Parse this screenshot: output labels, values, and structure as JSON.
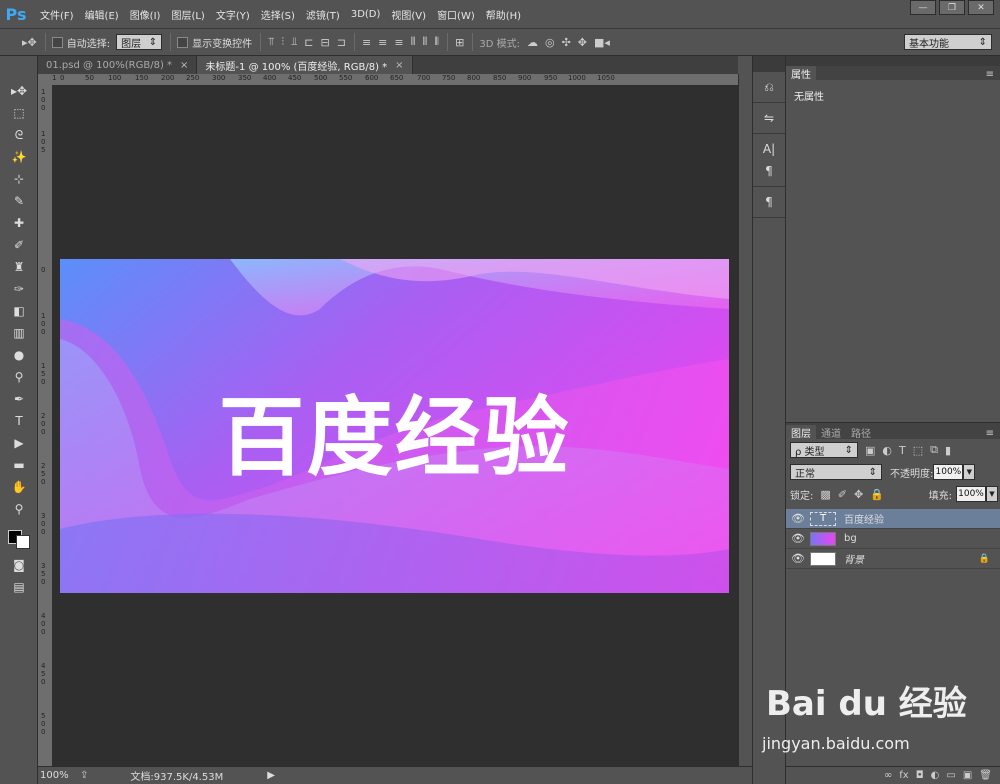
{
  "app": {
    "logo": "Ps"
  },
  "menu": [
    "文件(F)",
    "编辑(E)",
    "图像(I)",
    "图层(L)",
    "文字(Y)",
    "选择(S)",
    "滤镜(T)",
    "3D(D)",
    "视图(V)",
    "窗口(W)",
    "帮助(H)"
  ],
  "window_controls": {
    "minimize": "—",
    "restore": "❐",
    "close": "✕"
  },
  "options_bar": {
    "auto_select_label": "自动选择:",
    "auto_select_value": "图层",
    "show_transform_label": "显示变换控件",
    "mode_3d_label": "3D 模式:",
    "workspace_value": "基本功能"
  },
  "tabs": [
    {
      "label": "01.psd @ 100%(RGB/8) *",
      "close": "×"
    },
    {
      "label": "未标题-1 @ 100% (百度经验, RGB/8) *",
      "close": "×"
    }
  ],
  "ruler": {
    "h": [
      "1",
      "0",
      "50",
      "100",
      "150",
      "200",
      "250",
      "300",
      "350",
      "400",
      "450",
      "500",
      "550",
      "600",
      "650",
      "700",
      "750",
      "800",
      "850",
      "900",
      "950",
      "1000",
      "1050"
    ],
    "v": [
      "1",
      "0",
      "0",
      "1",
      "0",
      "5",
      "0",
      "1",
      "0",
      "0",
      "1",
      "5",
      "0",
      "2",
      "0",
      "0",
      "2",
      "5",
      "0",
      "3",
      "0",
      "0",
      "3",
      "5",
      "0",
      "4",
      "0",
      "0",
      "4",
      "5",
      "0",
      "5",
      "0",
      "0"
    ]
  },
  "artboard": {
    "text": "百度经验",
    "colors": {
      "top_left": "#5b8ff9",
      "right": "#e845f0",
      "bottom": "#b04ae8"
    }
  },
  "status": {
    "zoom": "100%",
    "doc_info": "文档:937.5K/4.53M"
  },
  "properties": {
    "tab": "属性",
    "body": "无属性"
  },
  "layers_panel": {
    "tabs": [
      "图层",
      "通道",
      "路径"
    ],
    "filter_value": "ρ 类型",
    "blend_mode": "正常",
    "opacity_label": "不透明度:",
    "opacity_value": "100%",
    "lock_label": "锁定:",
    "fill_label": "填充:",
    "fill_value": "100%",
    "layers": [
      {
        "name": "百度经验",
        "type": "text",
        "thumb_label": "T",
        "selected": true
      },
      {
        "name": "bg",
        "type": "image",
        "selected": false
      },
      {
        "name": "背景",
        "type": "background",
        "locked": true,
        "selected": false
      }
    ],
    "footer_icons": [
      "link-icon",
      "fx-icon",
      "mask-icon",
      "adjustment-icon",
      "folder-icon",
      "new-layer-icon",
      "trash-icon"
    ],
    "footer_labels": [
      "∞",
      "fx",
      "◘",
      "◐",
      "▭",
      "▣",
      "🗑"
    ]
  },
  "watermark": {
    "main": "Bai du 经验",
    "url": "jingyan.baidu.com"
  }
}
